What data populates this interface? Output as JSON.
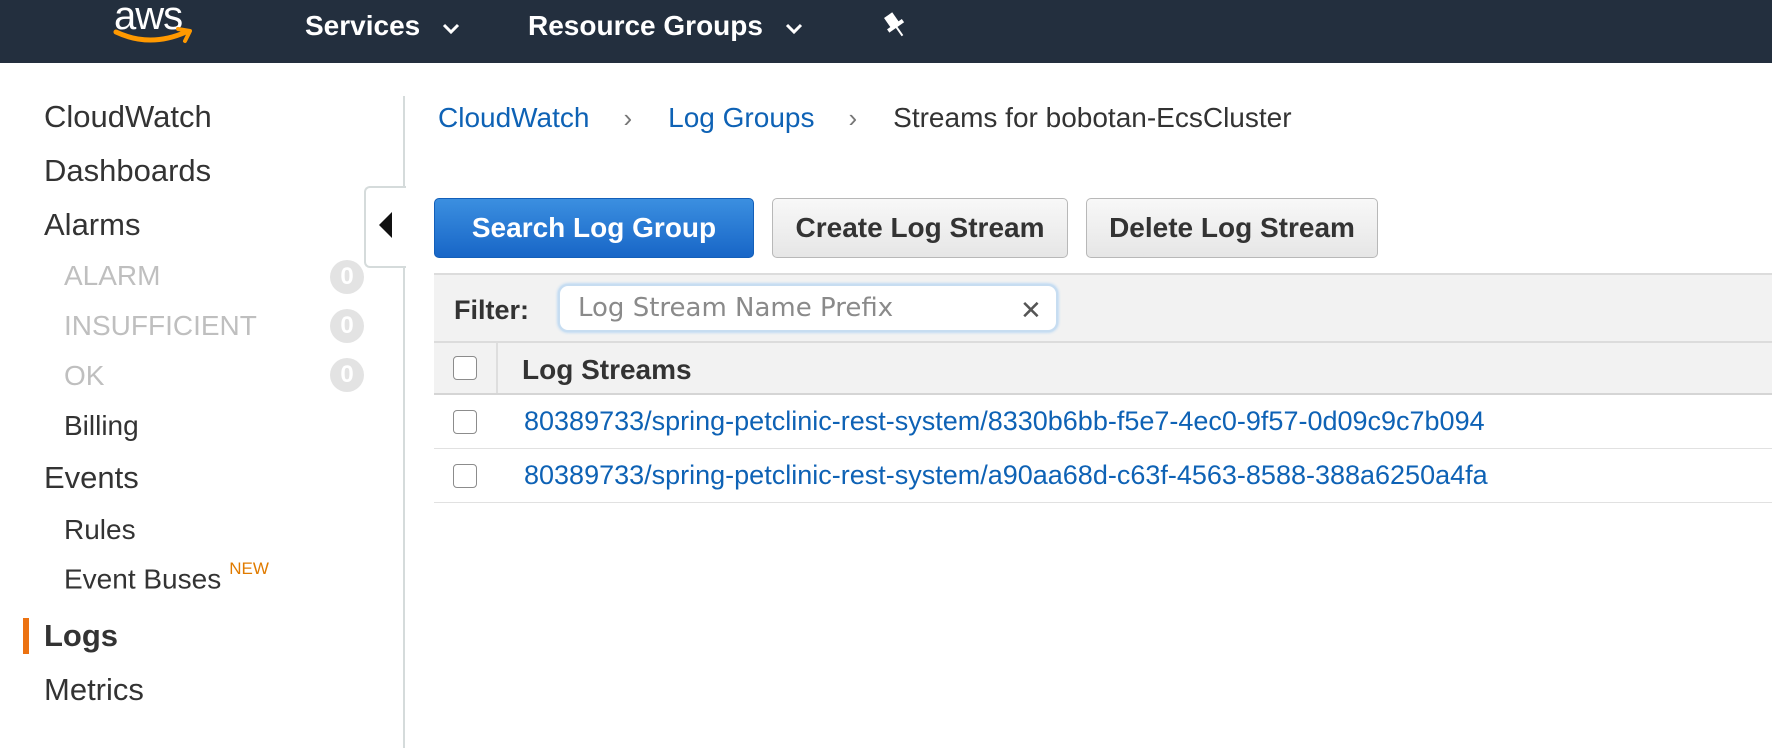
{
  "header": {
    "logo_text": "aws",
    "services_label": "Services",
    "resource_groups_label": "Resource Groups"
  },
  "sidebar": {
    "cloudwatch": "CloudWatch",
    "dashboards": "Dashboards",
    "alarms": "Alarms",
    "alarm_states": [
      {
        "label": "ALARM",
        "count": "0"
      },
      {
        "label": "INSUFFICIENT",
        "count": "0"
      },
      {
        "label": "OK",
        "count": "0"
      }
    ],
    "billing": "Billing",
    "events": "Events",
    "rules": "Rules",
    "event_buses": "Event Buses",
    "new_badge": "NEW",
    "logs": "Logs",
    "metrics": "Metrics"
  },
  "breadcrumb": {
    "items": [
      "CloudWatch",
      "Log Groups"
    ],
    "separator": "›",
    "current": "Streams for bobotan-EcsCluster"
  },
  "toolbar": {
    "search_label": "Search Log Group",
    "create_label": "Create Log Stream",
    "delete_label": "Delete Log Stream"
  },
  "filter": {
    "label": "Filter:",
    "placeholder": "Log Stream Name Prefix",
    "value": "",
    "clear_glyph": "✕"
  },
  "table": {
    "column": "Log Streams",
    "rows": [
      "80389733/spring-petclinic-rest-system/8330b6bb-f5e7-4ec0-9f57-0d09c9c7b094",
      "80389733/spring-petclinic-rest-system/a90aa68d-c63f-4563-8588-388a6250a4fa"
    ]
  },
  "colors": {
    "topbar": "#232f3e",
    "link": "#0e62b5",
    "primary_button": "#1866c7",
    "active_indicator": "#ec7211",
    "new_badge": "#e07b00"
  }
}
